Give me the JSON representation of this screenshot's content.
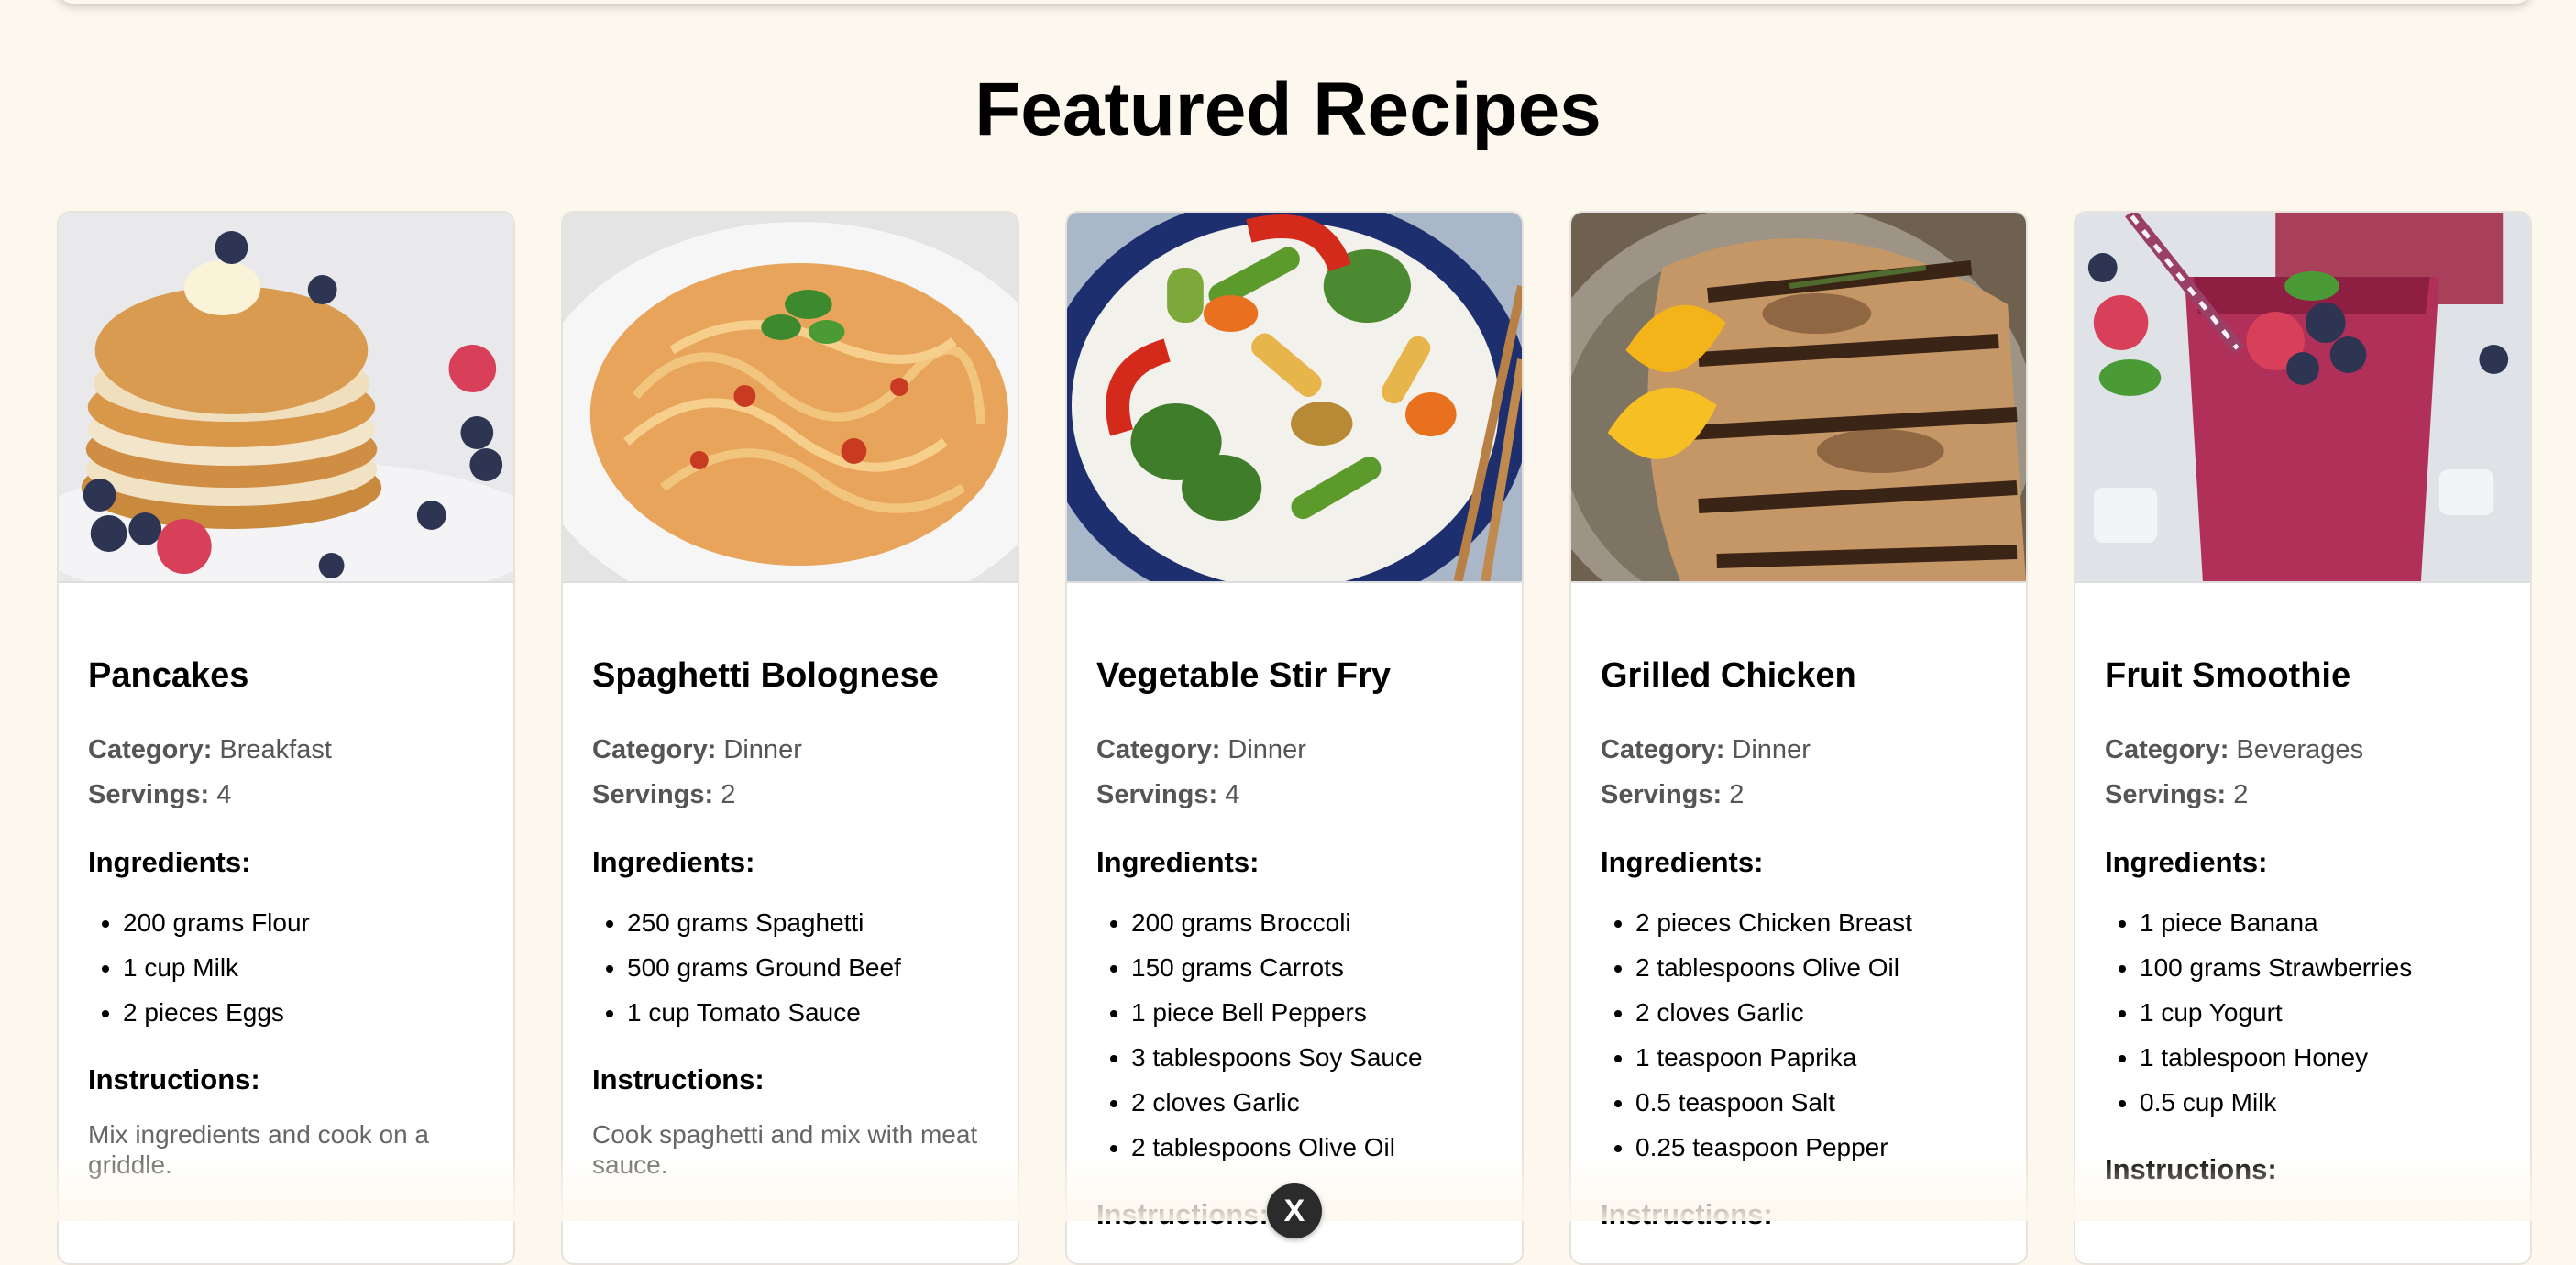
{
  "page": {
    "title": "Featured Recipes"
  },
  "labels": {
    "category": "Category:",
    "servings": "Servings:",
    "ingredients": "Ingredients:",
    "instructions": "Instructions:"
  },
  "recipes": [
    {
      "name": "Pancakes",
      "category": "Breakfast",
      "servings": "4",
      "ingredients": [
        "200 grams Flour",
        "1 cup Milk",
        "2 pieces Eggs"
      ],
      "instructions": "Mix ingredients and cook on a griddle."
    },
    {
      "name": "Spaghetti Bolognese",
      "category": "Dinner",
      "servings": "2",
      "ingredients": [
        "250 grams Spaghetti",
        "500 grams Ground Beef",
        "1 cup Tomato Sauce"
      ],
      "instructions": "Cook spaghetti and mix with meat sauce."
    },
    {
      "name": "Vegetable Stir Fry",
      "category": "Dinner",
      "servings": "4",
      "ingredients": [
        "200 grams Broccoli",
        "150 grams Carrots",
        "1 piece Bell Peppers",
        "3 tablespoons Soy Sauce",
        "2 cloves Garlic",
        "2 tablespoons Olive Oil"
      ],
      "instructions": ""
    },
    {
      "name": "Grilled Chicken",
      "category": "Dinner",
      "servings": "2",
      "ingredients": [
        "2 pieces Chicken Breast",
        "2 tablespoons Olive Oil",
        "2 cloves Garlic",
        "1 teaspoon Paprika",
        "0.5 teaspoon Salt",
        "0.25 teaspoon Pepper"
      ],
      "instructions": ""
    },
    {
      "name": "Fruit Smoothie",
      "category": "Beverages",
      "servings": "2",
      "ingredients": [
        "1 piece Banana",
        "100 grams Strawberries",
        "1 cup Yogurt",
        "1 tablespoon Honey",
        "0.5 cup Milk"
      ],
      "instructions": ""
    }
  ],
  "overlay": {
    "close_glyph": "X"
  },
  "colors": {
    "background": "#fdf8ee",
    "card": "#ffffff",
    "muted_text": "#555555"
  }
}
